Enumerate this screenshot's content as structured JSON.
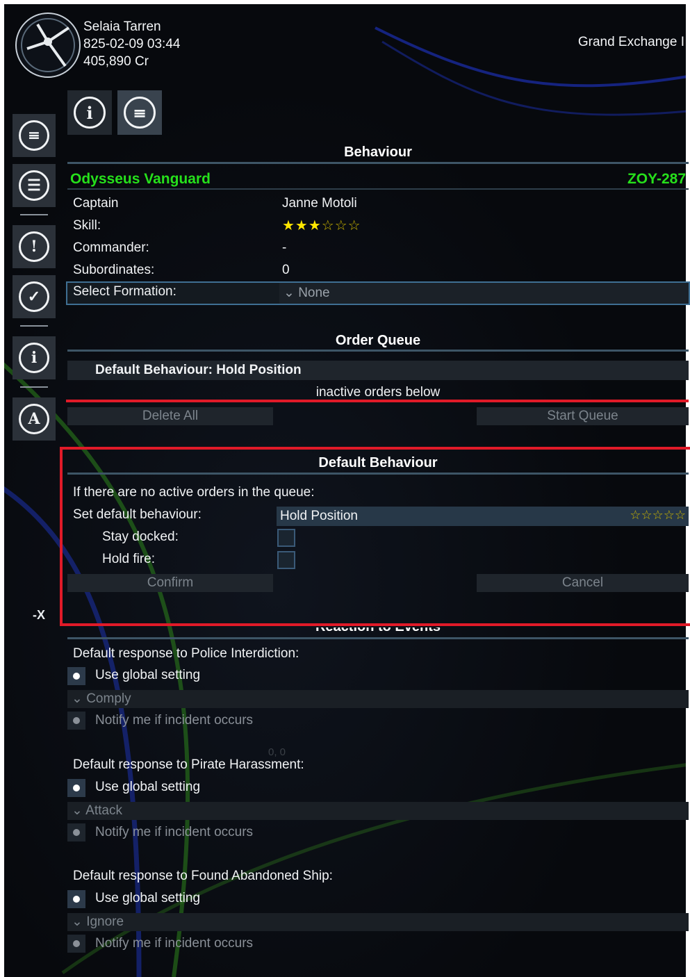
{
  "header": {
    "player_name": "Selaia Tarren",
    "datetime": "825-02-09 03:44",
    "credits": "405,890 Cr",
    "station": "Grand Exchange I"
  },
  "sidebar": {
    "icons": [
      "list-icon",
      "person-icon",
      "alert-icon",
      "check-icon",
      "info-icon",
      "compass-icon"
    ],
    "neg_x": "-X"
  },
  "tabs": [
    "info-icon",
    "list-icon"
  ],
  "behaviour": {
    "title": "Behaviour",
    "ship_name": "Odysseus Vanguard",
    "ship_id": "ZOY-287",
    "captain_label": "Captain",
    "captain_value": "Janne Motoli",
    "skill_label": "Skill:",
    "skill_stars": 3,
    "skill_max": 6,
    "commander_label": "Commander:",
    "commander_value": "-",
    "subordinates_label": "Subordinates:",
    "subordinates_value": "0",
    "formation_label": "Select Formation:",
    "formation_value": "None"
  },
  "order_queue": {
    "title": "Order Queue",
    "default_behaviour": "Default Behaviour: Hold Position",
    "inactive_note": "inactive orders below",
    "delete_all": "Delete All",
    "start_queue": "Start Queue"
  },
  "default_behaviour": {
    "title": "Default Behaviour",
    "intro": "If there are no active orders in the queue:",
    "set_label": "Set default behaviour:",
    "set_value": "Hold Position",
    "stars": "☆☆☆☆☆",
    "stay_docked": "Stay docked:",
    "hold_fire": "Hold fire:",
    "confirm": "Confirm",
    "cancel": "Cancel"
  },
  "reaction": {
    "title": "Reaction to Events",
    "sections": [
      {
        "label": "Default response to Police Interdiction:",
        "global": "Use global setting",
        "option": "Comply",
        "notify": "Notify me if incident occurs"
      },
      {
        "label": "Default response to Pirate Harassment:",
        "global": "Use global setting",
        "option": "Attack",
        "notify": "Notify me if incident occurs"
      },
      {
        "label": "Default response to Found Abandoned Ship:",
        "global": "Use global setting",
        "option": "Ignore",
        "notify": "Notify me if incident occurs"
      }
    ],
    "coord_text": "0, 0"
  },
  "colors": {
    "ship_accent": "#26e01b",
    "highlight_red": "#e01a28",
    "star_gold": "#ffe600"
  }
}
